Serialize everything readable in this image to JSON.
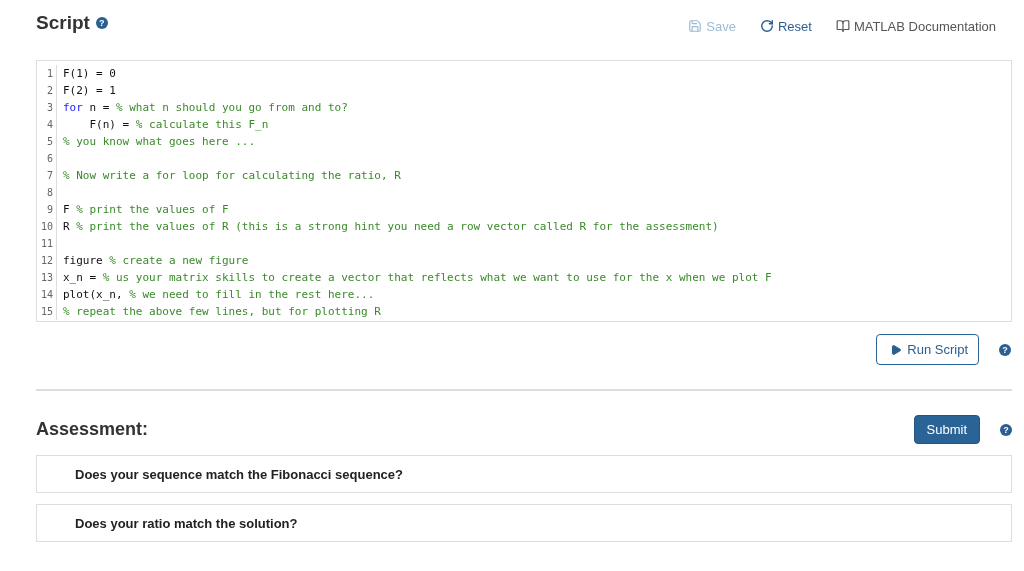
{
  "script": {
    "title": "Script",
    "help": "?",
    "toolbar": [
      {
        "kind": "save",
        "label": "Save",
        "disabled": true
      },
      {
        "kind": "reset",
        "label": "Reset",
        "disabled": false
      },
      {
        "kind": "docs",
        "label": "MATLAB Documentation",
        "disabled": false
      }
    ],
    "lines": [
      {
        "number": "1",
        "tokens": [
          {
            "kind": "code",
            "text": "F(1) = 0"
          }
        ]
      },
      {
        "number": "2",
        "tokens": [
          {
            "kind": "code",
            "text": "F(2) = 1"
          }
        ]
      },
      {
        "number": "3",
        "tokens": [
          {
            "kind": "keyword",
            "text": "for"
          },
          {
            "kind": "code",
            "text": " n = "
          },
          {
            "kind": "comment",
            "text": "% what n should you go from and to?"
          }
        ]
      },
      {
        "number": "4",
        "tokens": [
          {
            "kind": "code",
            "text": "    F(n) = "
          },
          {
            "kind": "comment",
            "text": "% calculate this F_n"
          }
        ]
      },
      {
        "number": "5",
        "tokens": [
          {
            "kind": "comment",
            "text": "% you know what goes here ..."
          }
        ]
      },
      {
        "number": "6"
      },
      {
        "number": "7",
        "tokens": [
          {
            "kind": "comment",
            "text": "% Now write a for loop for calculating the ratio, R"
          }
        ]
      },
      {
        "number": "8"
      },
      {
        "number": "9",
        "tokens": [
          {
            "kind": "code",
            "text": "F "
          },
          {
            "kind": "comment",
            "text": "% print the values of F"
          }
        ]
      },
      {
        "number": "10",
        "tokens": [
          {
            "kind": "code",
            "text": "R "
          },
          {
            "kind": "comment",
            "text": "% print the values of R (this is a strong hint you need a row vector called R for the assessment)"
          }
        ]
      },
      {
        "number": "11"
      },
      {
        "number": "12",
        "tokens": [
          {
            "kind": "code",
            "text": "figure "
          },
          {
            "kind": "comment",
            "text": "% create a new figure"
          }
        ]
      },
      {
        "number": "13",
        "tokens": [
          {
            "kind": "code",
            "text": "x_n = "
          },
          {
            "kind": "comment",
            "text": "% us your matrix skills to create a vector that reflects what we want to use for the x when we plot F"
          }
        ]
      },
      {
        "number": "14",
        "tokens": [
          {
            "kind": "code",
            "text": "plot(x_n, "
          },
          {
            "kind": "comment",
            "text": "% we need to fill in the rest here..."
          }
        ]
      },
      {
        "number": "15",
        "tokens": [
          {
            "kind": "comment",
            "text": "% repeat the above few lines, but for plotting R"
          }
        ]
      }
    ],
    "run_button": "Run Script",
    "run_help": "?"
  },
  "assessment": {
    "title": "Assessment:",
    "submit": "Submit",
    "help": "?",
    "tests": [
      "Does your sequence match the Fibonacci sequence?",
      "Does your ratio match the solution?"
    ]
  }
}
